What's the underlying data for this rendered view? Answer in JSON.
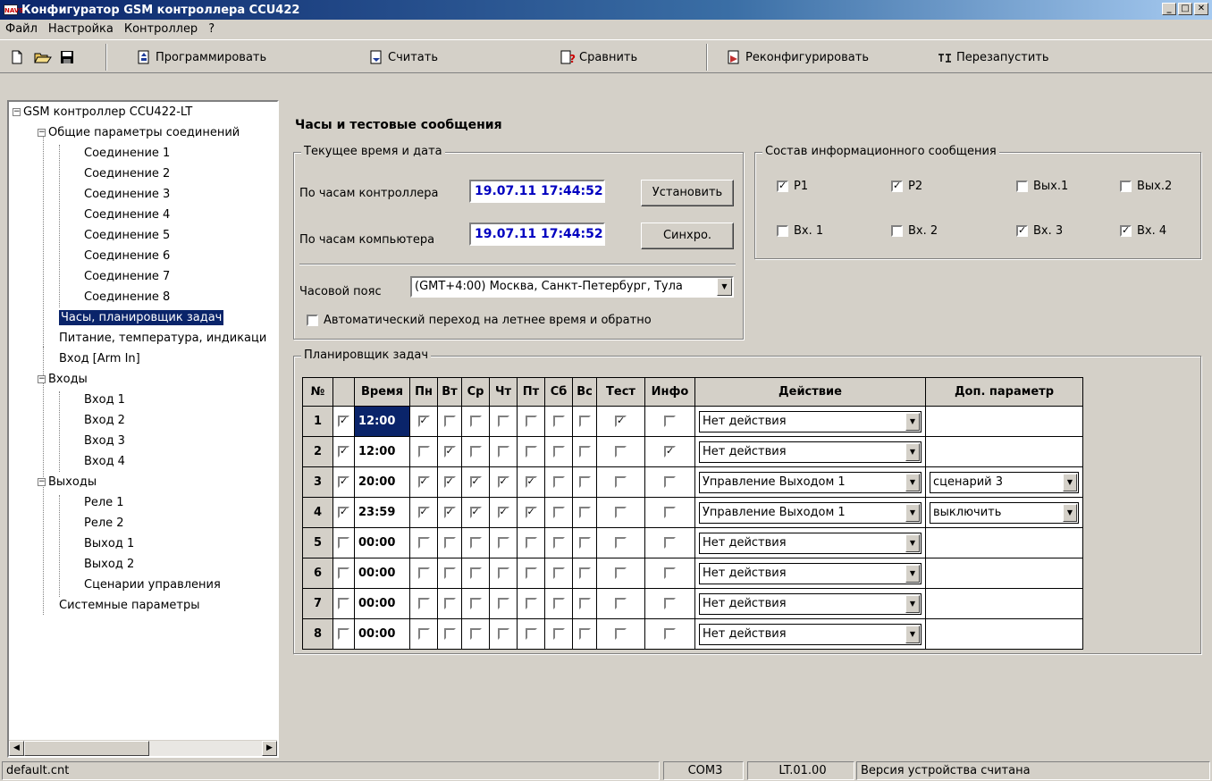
{
  "window": {
    "title": "Конфигуратор GSM контроллера CCU422",
    "icon_text": "NAVS",
    "minimize": "_",
    "maximize": "□",
    "close": "✕"
  },
  "menu": [
    "Файл",
    "Настройка",
    "Контроллер",
    "?"
  ],
  "toolbar": {
    "program": "Программировать",
    "read": "Считать",
    "compare": "Сравнить",
    "reconfigure": "Реконфигурировать",
    "restart": "Перезапустить"
  },
  "tree": {
    "root": "GSM контроллер CCU422-LT",
    "connections_group": "Общие параметры соединений",
    "connections": [
      "Соединение 1",
      "Соединение 2",
      "Соединение 3",
      "Соединение 4",
      "Соединение 5",
      "Соединение 6",
      "Соединение 7",
      "Соединение 8"
    ],
    "clock": "Часы, планировщик задач",
    "power": "Питание, температура, индикаци",
    "arm_in": "Вход [Arm In]",
    "inputs_group": "Входы",
    "inputs": [
      "Вход 1",
      "Вход 2",
      "Вход 3",
      "Вход 4"
    ],
    "outputs_group": "Выходы",
    "outputs": [
      "Реле 1",
      "Реле 2",
      "Выход 1",
      "Выход 2",
      "Сценарии управления"
    ],
    "system": "Системные параметры"
  },
  "main": {
    "title": "Часы и тестовые сообщения",
    "time_group": "Текущее время и дата",
    "controller_label": "По часам контроллера",
    "controller_time": "19.07.11 17:44:52",
    "set_button": "Установить",
    "pc_label": "По часам компьютера",
    "pc_time": "19.07.11 17:44:52",
    "sync_button": "Синхро.",
    "tz_label": "Часовой пояс",
    "tz_value": "(GMT+4:00) Москва, Санкт-Петербург, Тула",
    "dst_label": "Автоматический переход на летнее время и обратно",
    "dst_checked": false,
    "info_group": "Состав информационного сообщения",
    "info_items": [
      {
        "label": "P1",
        "checked": true
      },
      {
        "label": "P2",
        "checked": true
      },
      {
        "label": "Вых.1",
        "checked": false
      },
      {
        "label": "Вых.2",
        "checked": false
      },
      {
        "label": "Вх. 1",
        "checked": false
      },
      {
        "label": "Вх. 2",
        "checked": false
      },
      {
        "label": "Вх. 3",
        "checked": true
      },
      {
        "label": "Вх. 4",
        "checked": true
      }
    ],
    "scheduler_group": "Планировщик задач"
  },
  "scheduler": {
    "headers": [
      "№",
      "",
      "Время",
      "Пн",
      "Вт",
      "Ср",
      "Чт",
      "Пт",
      "Сб",
      "Вс",
      "Тест",
      "Инфо",
      "Действие",
      "Доп. параметр"
    ],
    "rows": [
      {
        "n": "1",
        "en": true,
        "time": "12:00",
        "days": [
          true,
          false,
          false,
          false,
          false,
          false,
          false
        ],
        "test": true,
        "info": false,
        "action": "Нет действия",
        "param": ""
      },
      {
        "n": "2",
        "en": true,
        "time": "12:00",
        "days": [
          false,
          true,
          false,
          false,
          false,
          false,
          false
        ],
        "test": false,
        "info": true,
        "action": "Нет действия",
        "param": ""
      },
      {
        "n": "3",
        "en": true,
        "time": "20:00",
        "days": [
          true,
          true,
          true,
          true,
          true,
          false,
          false
        ],
        "test": false,
        "info": false,
        "action": "Управление Выходом 1",
        "param": "сценарий 3"
      },
      {
        "n": "4",
        "en": true,
        "time": "23:59",
        "days": [
          true,
          true,
          true,
          true,
          true,
          false,
          false
        ],
        "test": false,
        "info": false,
        "action": "Управление Выходом 1",
        "param": "выключить"
      },
      {
        "n": "5",
        "en": false,
        "time": "00:00",
        "days": [
          false,
          false,
          false,
          false,
          false,
          false,
          false
        ],
        "test": false,
        "info": false,
        "action": "Нет действия",
        "param": ""
      },
      {
        "n": "6",
        "en": false,
        "time": "00:00",
        "days": [
          false,
          false,
          false,
          false,
          false,
          false,
          false
        ],
        "test": false,
        "info": false,
        "action": "Нет действия",
        "param": ""
      },
      {
        "n": "7",
        "en": false,
        "time": "00:00",
        "days": [
          false,
          false,
          false,
          false,
          false,
          false,
          false
        ],
        "test": false,
        "info": false,
        "action": "Нет действия",
        "param": ""
      },
      {
        "n": "8",
        "en": false,
        "time": "00:00",
        "days": [
          false,
          false,
          false,
          false,
          false,
          false,
          false
        ],
        "test": false,
        "info": false,
        "action": "Нет действия",
        "param": ""
      }
    ]
  },
  "status": {
    "file": "default.cnt",
    "port": "COM3",
    "version": "LT.01.00",
    "message": "Версия устройства считана"
  }
}
